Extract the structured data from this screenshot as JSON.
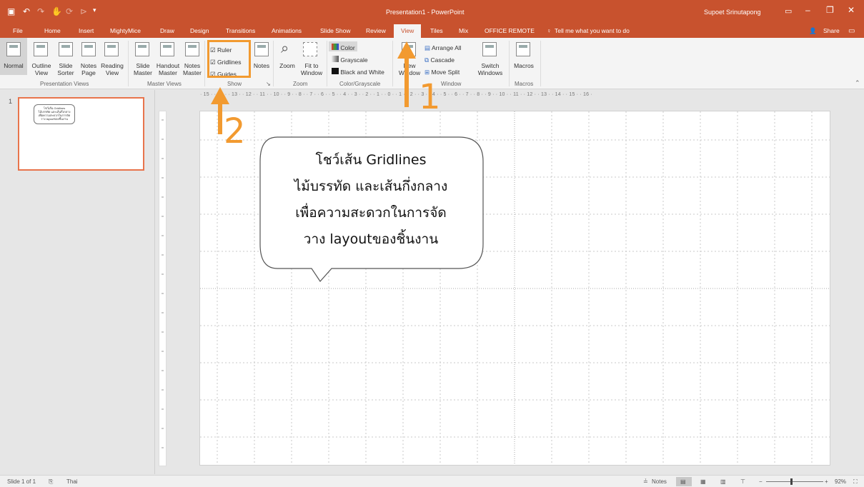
{
  "window": {
    "title": "Presentation1 - PowerPoint",
    "user": "Supoet Srinutapong"
  },
  "tabs": [
    "File",
    "Home",
    "Insert",
    "MightyMice",
    "Draw",
    "Design",
    "Transitions",
    "Animations",
    "Slide Show",
    "Review",
    "View",
    "Tiles",
    "Mix",
    "OFFICE REMOTE"
  ],
  "active_tab": "View",
  "tell_me": "Tell me what you want to do",
  "share_label": "Share",
  "ribbon": {
    "presentation_views": {
      "label": "Presentation Views",
      "buttons": [
        "Normal",
        "Outline View",
        "Slide Sorter",
        "Notes Page",
        "Reading View"
      ]
    },
    "master_views": {
      "label": "Master Views",
      "buttons": [
        "Slide Master",
        "Handout Master",
        "Notes Master"
      ]
    },
    "show": {
      "label": "Show",
      "checks": [
        "Ruler",
        "Gridlines",
        "Guides"
      ],
      "notes": "Notes"
    },
    "zoom": {
      "label": "Zoom",
      "buttons": [
        "Zoom",
        "Fit to Window"
      ]
    },
    "color": {
      "label": "Color/Grayscale",
      "options": [
        "Color",
        "Grayscale",
        "Black and White"
      ]
    },
    "window": {
      "label": "Window",
      "new_window": "New Window",
      "items": [
        "Arrange All",
        "Cascade",
        "Move Split"
      ],
      "switch": "Switch Windows"
    },
    "macros": {
      "label": "Macros",
      "button": "Macros"
    }
  },
  "thumbnail": {
    "number": "1"
  },
  "ruler": {
    "top": "· 15 · · 14 · · 13 · · 12 · · 11 · · 10 · · 9 · · 8 · · 7 · · 6 · · 5 · · 4 · · 3 · · 2 · · 1 · · 0 · · 1 · · 2 · · 3 · · 4 · · 5 · · 6 · · 7 · · 8 · · 9 · · 10 · · 11 · · 12 · · 13 · · 14 · · 15 · · 16 ·"
  },
  "callout": {
    "lines": [
      "โชว์เส้น Gridlines",
      "ไม้บรรทัด และเส้นกึ่งกลาง",
      "เพื่อความสะดวกในการจัด",
      "วาง layoutของชิ้นงาน"
    ]
  },
  "annotations": {
    "arrow1": "1",
    "arrow2": "2",
    "color": "#f29a30"
  },
  "status": {
    "slide": "Slide 1 of 1",
    "language": "Thai",
    "notes": "Notes",
    "zoom": "92%"
  }
}
